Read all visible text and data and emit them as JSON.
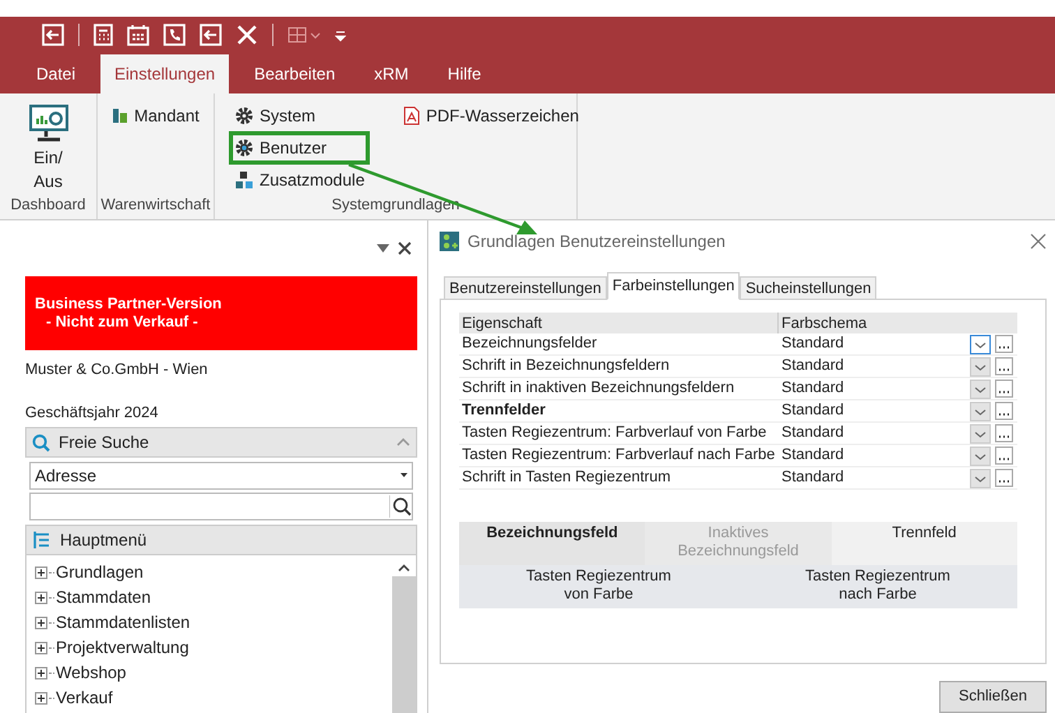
{
  "ribbon": {
    "tabs": [
      {
        "label": "Datei",
        "selected": false
      },
      {
        "label": "Einstellungen",
        "selected": true
      },
      {
        "label": "Bearbeiten",
        "selected": false
      },
      {
        "label": "xRM",
        "selected": false
      },
      {
        "label": "Hilfe",
        "selected": false
      }
    ],
    "groups": [
      {
        "label": "Dashboard",
        "items": [
          {
            "label": "Ein/\nAus",
            "kind": "large"
          }
        ]
      },
      {
        "label": "Warenwirtschaft",
        "items": [
          {
            "label": "Mandant",
            "kind": "small"
          }
        ]
      },
      {
        "label": "Systemgrundlagen",
        "items": [
          {
            "label": "System",
            "kind": "small",
            "highlighted": false
          },
          {
            "label": "Benutzer",
            "kind": "small",
            "highlighted": true
          },
          {
            "label": "Zusatzmodule",
            "kind": "small",
            "highlighted": false
          },
          {
            "label": "PDF-Wasserzeichen",
            "kind": "small",
            "highlighted": false
          }
        ]
      }
    ]
  },
  "sidebar": {
    "banner": [
      "Business Partner-Version",
      "- Nicht zum Verkauf -"
    ],
    "company": "Muster & Co.GmbH - Wien",
    "fiscal_year": "Geschäftsjahr 2024",
    "search_header": "Freie Suche",
    "search_type": "Adresse",
    "menu_header": "Hauptmenü",
    "tree": [
      {
        "label": "Grundlagen",
        "expanded": false
      },
      {
        "label": "Stammdaten",
        "expanded": false
      },
      {
        "label": "Stammdatenlisten",
        "expanded": false
      },
      {
        "label": "Projektverwaltung",
        "expanded": false
      },
      {
        "label": "Webshop",
        "expanded": false
      },
      {
        "label": "Verkauf",
        "expanded": false
      }
    ]
  },
  "dialog": {
    "title": "Grundlagen Benutzereinstellungen",
    "tabs": [
      {
        "label": "Benutzereinstellungen",
        "selected": false
      },
      {
        "label": "Farbeinstellungen",
        "selected": true
      },
      {
        "label": "Sucheinstellungen",
        "selected": false
      }
    ],
    "columns": [
      "Eigenschaft",
      "Farbschema"
    ],
    "rows": [
      {
        "property": "Bezeichnungsfelder",
        "scheme": "Standard",
        "bold": false,
        "focused": true
      },
      {
        "property": "Schrift in Bezeichnungsfeldern",
        "scheme": "Standard",
        "bold": false,
        "focused": false
      },
      {
        "property": "Schrift in inaktiven Bezeichnungsfeldern",
        "scheme": "Standard",
        "bold": false,
        "focused": false
      },
      {
        "property": "Trennfelder",
        "scheme": "Standard",
        "bold": true,
        "focused": false
      },
      {
        "property": "Tasten Regiezentrum: Farbverlauf von Farbe",
        "scheme": "Standard",
        "bold": false,
        "focused": false
      },
      {
        "property": "Tasten Regiezentrum: Farbverlauf nach Farbe",
        "scheme": "Standard",
        "bold": false,
        "focused": false
      },
      {
        "property": "Schrift in Tasten Regiezentrum",
        "scheme": "Standard",
        "bold": false,
        "focused": false
      }
    ],
    "preview": [
      [
        {
          "label": "Bezeichnungsfeld",
          "kind": "bold"
        },
        {
          "label": "Inaktives\nBezeichnungsfeld",
          "kind": "inactive"
        },
        {
          "label": "Trennfeld",
          "kind": "normal"
        }
      ],
      [
        {
          "label": "Tasten Regiezentrum\nvon Farbe",
          "kind": "normal"
        },
        {
          "label": "Tasten Regiezentrum\nnach Farbe",
          "kind": "normal"
        }
      ]
    ],
    "close_button": "Schließen"
  }
}
